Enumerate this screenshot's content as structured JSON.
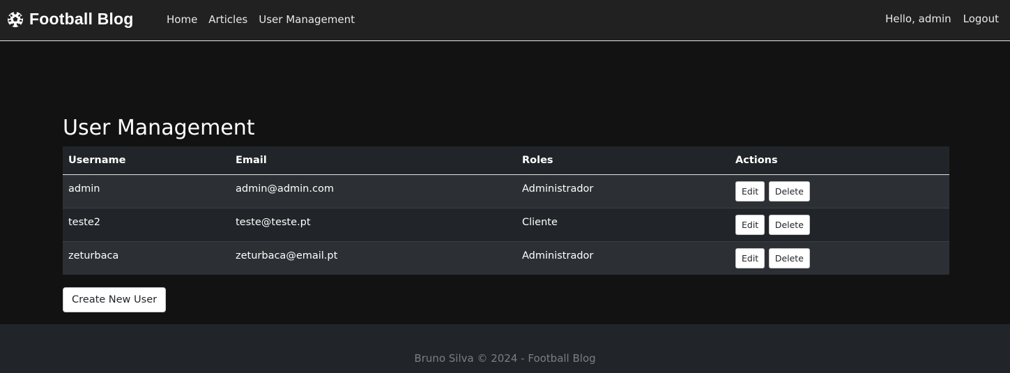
{
  "navbar": {
    "brand": "Football Blog",
    "brand_icon": "soccer-ball-icon",
    "links": [
      "Home",
      "Articles",
      "User Management"
    ],
    "greeting": "Hello, admin",
    "logout": "Logout"
  },
  "page": {
    "title": "User Management"
  },
  "table": {
    "headers": [
      "Username",
      "Email",
      "Roles",
      "Actions"
    ],
    "rows": [
      {
        "username": "admin",
        "email": "admin@admin.com",
        "role": "Administrador",
        "edit": "Edit",
        "delete": "Delete"
      },
      {
        "username": "teste2",
        "email": "teste@teste.pt",
        "role": "Cliente",
        "edit": "Edit",
        "delete": "Delete"
      },
      {
        "username": "zeturbaca",
        "email": "zeturbaca@email.pt",
        "role": "Administrador",
        "edit": "Edit",
        "delete": "Delete"
      }
    ]
  },
  "create_button": "Create New User",
  "footer": {
    "text": "Bruno Silva © 2024 - Football Blog"
  },
  "colors": {
    "background": "#121212",
    "navbar": "#212121",
    "table_header": "#212529",
    "row_odd": "#2c3034",
    "row_even": "#212529",
    "footer_text": "#7b7f84"
  }
}
